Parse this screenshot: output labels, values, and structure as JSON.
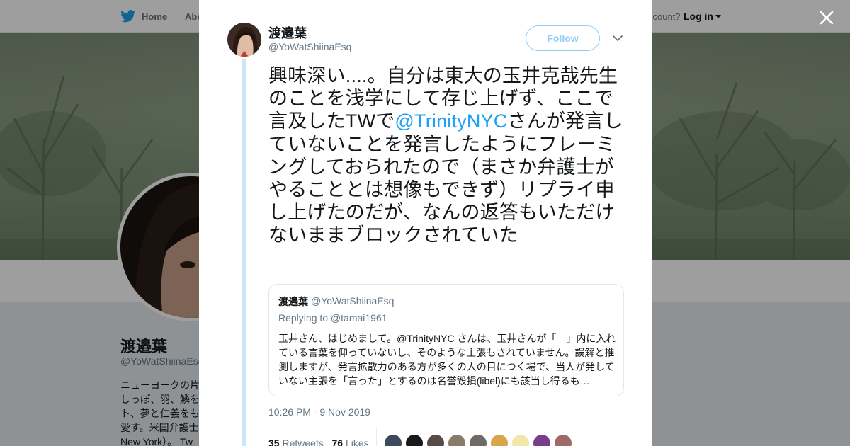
{
  "nav": {
    "home": "Home",
    "about": "Abo",
    "account_prompt": "ccount?",
    "login": "Log in"
  },
  "profile": {
    "name": "渡邉葉",
    "handle": "@YoWatShiinaEsq",
    "bio_lines": [
      "ニューヨークの片",
      "しっぽ、羽、鱗を",
      "ト、夢と仁義をも",
      "愛す。米国弁護士",
      "New York）。 Tw"
    ]
  },
  "tweet": {
    "author_name": "渡邉葉",
    "author_handle": "@YoWatShiinaEsq",
    "follow_label": "Follow",
    "text_before": "興味深い....。自分は東大の玉井克哉先生のことを浅学にして存じ上げず、ここで言及したTWで",
    "mention": "@TrinityNYC",
    "text_after": "さんが発言していないことを発言したようにフレーミングしておられたので（まさか弁護士がやることとは想像もできず）リプライ申し上げたのだが、なんの返答もいただけないままブロックされていた",
    "timestamp": "10:26 PM - 9 Nov 2019",
    "retweets_count": "35",
    "retweets_label": "Retweets",
    "likes_count": "76",
    "likes_label": "Likes"
  },
  "quoted": {
    "name": "渡邉葉",
    "handle": "@YoWatShiinaEsq",
    "replying_to": "Replying to @tamai1961",
    "text": "玉井さん、はじめまして。@TrinityNYC さんは、玉井さんが「　」内に入れている言葉を仰っていないし、そのような主張もされていません。誤解と推測しますが、発言拡散力のある方が多くの人の目につく場で、当人が発していない主張を「言った」とするのは名誉毀損(libel)にも該当し得るも…"
  },
  "likers": [
    "liker-1",
    "liker-2",
    "liker-3",
    "liker-4",
    "liker-5",
    "liker-6",
    "liker-7",
    "liker-8",
    "liker-9"
  ],
  "colors": {
    "accent": "#1da1f2",
    "follow_border": "#8ecdf8",
    "thread_line": "#cce6f7"
  }
}
